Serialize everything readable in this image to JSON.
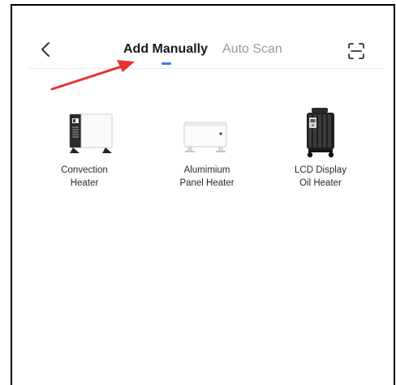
{
  "header": {
    "tabs": [
      {
        "label": "Add Manually",
        "active": true
      },
      {
        "label": "Auto Scan",
        "active": false
      }
    ],
    "accent_color": "#3d7ee8"
  },
  "devices": [
    {
      "line1": "Convection",
      "line2": "Heater",
      "icon": "convection-heater"
    },
    {
      "line1": "Alumimium",
      "line2": "Panel Heater",
      "icon": "panel-heater"
    },
    {
      "line1": "LCD Display",
      "line2": "Oil Heater",
      "icon": "oil-heater"
    }
  ],
  "annotation": {
    "type": "red-arrow",
    "color": "#e8322b",
    "points_to": "Add Manually"
  }
}
